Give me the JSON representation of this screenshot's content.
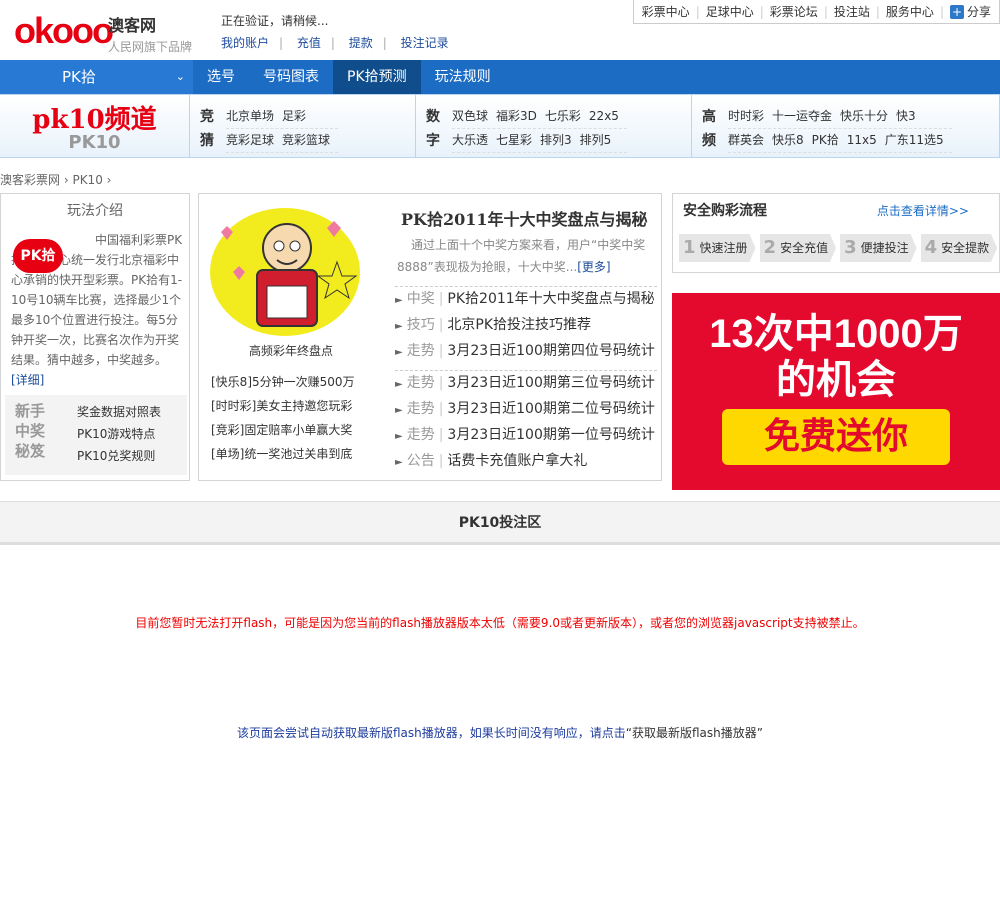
{
  "header": {
    "logo_text": "okooo",
    "brand_name": "澳客网",
    "brand_slogan": "人民网旗下品牌",
    "verify_text": "正在验证，请稍候...",
    "account_links": [
      "我的账户",
      "充值",
      "提款",
      "投注记录"
    ],
    "top_links": [
      "彩票中心",
      "足球中心",
      "彩票论坛",
      "投注站",
      "服务中心"
    ],
    "share_label": "分享"
  },
  "nav": {
    "current_game": "PK拾",
    "items": [
      "选号",
      "号码图表",
      "PK拾预测",
      "玩法规则"
    ],
    "active_index": 2
  },
  "channel": {
    "title": "pk10频道",
    "subtitle": "PK10",
    "groups": [
      {
        "label": [
          "竞",
          "猜"
        ],
        "rows": [
          [
            "北京单场",
            "足彩"
          ],
          [
            "竞彩足球",
            "竞彩篮球"
          ]
        ]
      },
      {
        "label": [
          "数",
          "字"
        ],
        "rows": [
          [
            "双色球",
            "福彩3D",
            "七乐彩",
            "22x5"
          ],
          [
            "大乐透",
            "七星彩",
            "排列3",
            "排列5"
          ]
        ]
      },
      {
        "label": [
          "高",
          "频"
        ],
        "rows": [
          [
            "时时彩",
            "十一运夺金",
            "快乐十分",
            "快3"
          ],
          [
            "群英会",
            "快乐8",
            "PK拾",
            "11x5",
            "广东11选5"
          ]
        ]
      }
    ]
  },
  "breadcrumb": [
    "澳客彩票网",
    "PK10"
  ],
  "intro": {
    "title": "玩法介绍",
    "icon_label": "PK拾",
    "description": "中国福利彩票PK拾福彩中心统一发行北京福彩中心承销的快开型彩票。PK拾有1-10号10辆车比赛，选择最少1个最多10个位置进行投注。每5分钟开奖一次，比赛名次作为开奖结果。猜中越多，中奖越多。",
    "more_label": "[详细]",
    "tips_side": [
      "新手",
      "中奖",
      "秘笈"
    ],
    "tips_links": [
      "奖金数据对照表",
      "PK10游戏特点",
      "PK10兑奖规则"
    ]
  },
  "news": {
    "image_caption": "高频彩年终盘点",
    "left_links": [
      "[快乐8]5分钟一次赚500万",
      "[时时彩]美女主持邀您玩彩",
      "[竞彩]固定赔率小单赢大奖",
      "[单场]统一奖池过关串到底"
    ],
    "headline": "PK拾2011年十大中奖盘点与揭秘",
    "summary": "通过上面十个中奖方案来看，用户“中奖中奖8888”表现极为抢眼，十大中奖...",
    "summary_more": "[更多]",
    "list_a": [
      {
        "cat": "中奖",
        "title": "PK拾2011年十大中奖盘点与揭秘"
      },
      {
        "cat": "技巧",
        "title": "北京PK拾投注技巧推荐"
      },
      {
        "cat": "走势",
        "title": "3月23日近100期第四位号码统计"
      }
    ],
    "list_b": [
      {
        "cat": "走势",
        "title": "3月23日近100期第三位号码统计"
      },
      {
        "cat": "走势",
        "title": "3月23日近100期第二位号码统计"
      },
      {
        "cat": "走势",
        "title": "3月23日近100期第一位号码统计"
      },
      {
        "cat": "公告",
        "title": "话费卡充值账户拿大礼"
      }
    ]
  },
  "process": {
    "title": "安全购彩流程",
    "detail_link": "点击查看详情>>",
    "steps": [
      {
        "num": "1",
        "label": "快速注册"
      },
      {
        "num": "2",
        "label": "安全充值"
      },
      {
        "num": "3",
        "label": "便捷投注"
      },
      {
        "num": "4",
        "label": "安全提款"
      }
    ]
  },
  "banner": {
    "line1": "13次中1000万",
    "line2": "的机会",
    "button": "免费送你"
  },
  "bet_area": {
    "title": "PK10投注区",
    "flash_error": "目前您暂时无法打开flash，可能是因为您当前的flash播放器版本太低（需要9.0或者更新版本），或者您的浏览器javascript支持被禁止。",
    "flash_update": "该页面会尝试自动获取最新版flash播放器，如果长时间没有响应，请点击",
    "flash_update_link": "“获取最新版flash播放器”"
  },
  "colors": {
    "brand_red": "#e60012",
    "nav_blue": "#1d6cc4",
    "link_blue": "#1d4b9c"
  }
}
